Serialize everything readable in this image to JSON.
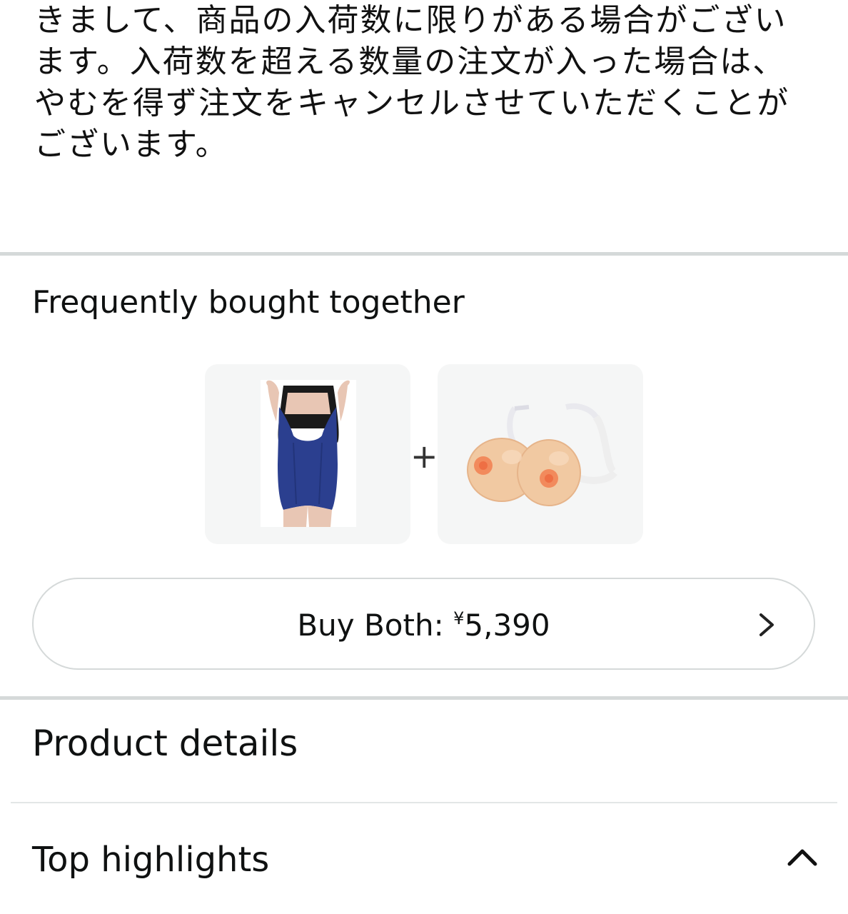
{
  "notice": {
    "lines": [
      "きまして、商品の入荷数に限りがある場合がござい",
      "ます。入荷数を超える数量の注文が入った場合は、",
      "やむを得ず注文をキャンセルさせていただくことが",
      "ございます。"
    ]
  },
  "frequently_bought": {
    "title": "Frequently bought together",
    "plus_sign": "+",
    "products": [
      {
        "icon": "swimsuit-product-image"
      },
      {
        "icon": "breast-form-product-image"
      }
    ],
    "buy_button": {
      "label_prefix": "Buy Both: ",
      "currency": "¥",
      "amount": "5,390",
      "icon": "chevron-right-icon"
    }
  },
  "product_details": {
    "title": "Product details"
  },
  "top_highlights": {
    "title": "Top highlights",
    "icon": "chevron-up-icon"
  },
  "colors": {
    "divider": "#d5d9d9",
    "tile_bg": "#f5f6f6",
    "text": "#0f1111",
    "swimsuit": "#2b3f8f"
  }
}
